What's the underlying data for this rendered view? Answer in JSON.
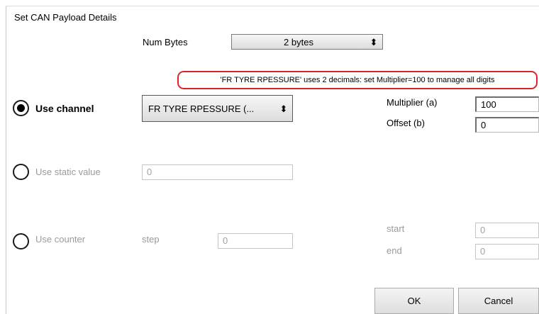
{
  "dialog": {
    "title": "Set CAN Payload Details"
  },
  "num_bytes": {
    "label": "Num Bytes",
    "value": "2 bytes"
  },
  "notice": "'FR TYRE RPESSURE' uses 2 decimals: set Multiplier=100 to manage all digits",
  "use_channel": {
    "label": "Use channel",
    "selected": true,
    "channel_value": "FR TYRE RPESSURE (...",
    "multiplier_label": "Multiplier (a)",
    "multiplier_value": "100",
    "offset_label": "Offset (b)",
    "offset_value": "0"
  },
  "use_static": {
    "label": "Use static value",
    "selected": false,
    "value": "0"
  },
  "use_counter": {
    "label": "Use counter",
    "selected": false,
    "step_label": "step",
    "step_value": "0",
    "start_label": "start",
    "start_value": "0",
    "end_label": "end",
    "end_value": "0"
  },
  "buttons": {
    "ok": "OK",
    "cancel": "Cancel"
  },
  "icons": {
    "select_arrows": "up-down-arrows-icon"
  },
  "colors": {
    "notice_border": "#d9252a"
  }
}
